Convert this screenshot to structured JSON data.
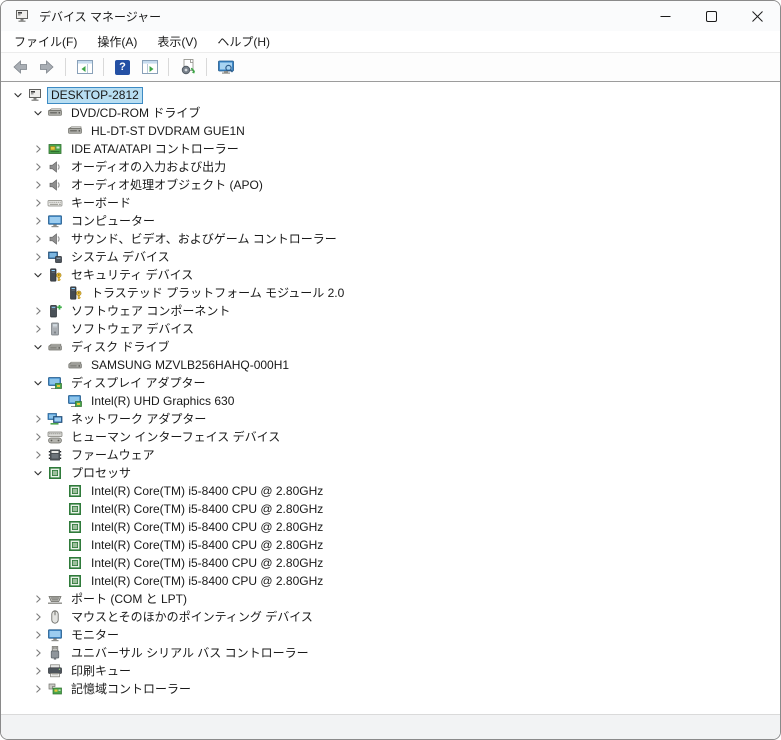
{
  "window": {
    "title": "デバイス マネージャー"
  },
  "window_controls": {
    "minimize_icon": "minimize-icon",
    "maximize_icon": "maximize-icon",
    "close_icon": "close-icon"
  },
  "menu": {
    "items": [
      {
        "id": "file",
        "label": "ファイル(F)"
      },
      {
        "id": "action",
        "label": "操作(A)"
      },
      {
        "id": "view",
        "label": "表示(V)"
      },
      {
        "id": "help",
        "label": "ヘルプ(H)"
      }
    ]
  },
  "toolbar": {
    "buttons": [
      {
        "name": "back",
        "icon": "back-arrow-icon"
      },
      {
        "name": "forward",
        "icon": "forward-arrow-icon"
      },
      {
        "type": "separator"
      },
      {
        "name": "show-console-tree",
        "icon": "show-tree-icon"
      },
      {
        "type": "separator"
      },
      {
        "name": "help",
        "icon": "help-icon"
      },
      {
        "name": "show-action-pane",
        "icon": "show-pane-icon"
      },
      {
        "type": "separator"
      },
      {
        "name": "scan-hardware-changes",
        "icon": "scan-hardware-icon"
      },
      {
        "type": "separator"
      },
      {
        "name": "remote-computer",
        "icon": "remote-monitor-icon"
      }
    ]
  },
  "tree": {
    "items": [
      {
        "label": "DESKTOP-2812",
        "icon": "computer-icon",
        "level": 0,
        "state": "expanded",
        "selected": true
      },
      {
        "label": "DVD/CD-ROM ドライブ",
        "icon": "cd-drive-icon",
        "level": 1,
        "state": "expanded"
      },
      {
        "label": "HL-DT-ST DVDRAM GUE1N",
        "icon": "cd-drive-icon",
        "level": 2,
        "state": "leaf"
      },
      {
        "label": "IDE ATA/ATAPI コントローラー",
        "icon": "ide-controller-icon",
        "level": 1,
        "state": "collapsed"
      },
      {
        "label": "オーディオの入力および出力",
        "icon": "speaker-icon",
        "level": 1,
        "state": "collapsed"
      },
      {
        "label": "オーディオ処理オブジェクト (APO)",
        "icon": "speaker-icon",
        "level": 1,
        "state": "collapsed"
      },
      {
        "label": "キーボード",
        "icon": "keyboard-icon",
        "level": 1,
        "state": "collapsed"
      },
      {
        "label": "コンピューター",
        "icon": "monitor-icon",
        "level": 1,
        "state": "collapsed"
      },
      {
        "label": "サウンド、ビデオ、およびゲーム コントローラー",
        "icon": "speaker-icon",
        "level": 1,
        "state": "collapsed"
      },
      {
        "label": "システム デバイス",
        "icon": "system-device-icon",
        "level": 1,
        "state": "collapsed"
      },
      {
        "label": "セキュリティ デバイス",
        "icon": "security-device-icon",
        "level": 1,
        "state": "expanded"
      },
      {
        "label": "トラステッド プラットフォーム モジュール 2.0",
        "icon": "security-device-icon",
        "level": 2,
        "state": "leaf"
      },
      {
        "label": "ソフトウェア コンポーネント",
        "icon": "software-component-icon",
        "level": 1,
        "state": "collapsed"
      },
      {
        "label": "ソフトウェア デバイス",
        "icon": "software-device-icon",
        "level": 1,
        "state": "collapsed"
      },
      {
        "label": "ディスク ドライブ",
        "icon": "disk-drive-icon",
        "level": 1,
        "state": "expanded"
      },
      {
        "label": "SAMSUNG MZVLB256HAHQ-000H1",
        "icon": "disk-drive-icon",
        "level": 2,
        "state": "leaf"
      },
      {
        "label": "ディスプレイ アダプター",
        "icon": "display-adapter-icon",
        "level": 1,
        "state": "expanded"
      },
      {
        "label": "Intel(R) UHD Graphics 630",
        "icon": "display-adapter-icon",
        "level": 2,
        "state": "leaf"
      },
      {
        "label": "ネットワーク アダプター",
        "icon": "network-adapter-icon",
        "level": 1,
        "state": "collapsed"
      },
      {
        "label": "ヒューマン インターフェイス デバイス",
        "icon": "hid-icon",
        "level": 1,
        "state": "collapsed"
      },
      {
        "label": "ファームウェア",
        "icon": "firmware-icon",
        "level": 1,
        "state": "collapsed"
      },
      {
        "label": "プロセッサ",
        "icon": "processor-icon",
        "level": 1,
        "state": "expanded"
      },
      {
        "label": "Intel(R) Core(TM) i5-8400 CPU @ 2.80GHz",
        "icon": "processor-icon",
        "level": 2,
        "state": "leaf"
      },
      {
        "label": "Intel(R) Core(TM) i5-8400 CPU @ 2.80GHz",
        "icon": "processor-icon",
        "level": 2,
        "state": "leaf"
      },
      {
        "label": "Intel(R) Core(TM) i5-8400 CPU @ 2.80GHz",
        "icon": "processor-icon",
        "level": 2,
        "state": "leaf"
      },
      {
        "label": "Intel(R) Core(TM) i5-8400 CPU @ 2.80GHz",
        "icon": "processor-icon",
        "level": 2,
        "state": "leaf"
      },
      {
        "label": "Intel(R) Core(TM) i5-8400 CPU @ 2.80GHz",
        "icon": "processor-icon",
        "level": 2,
        "state": "leaf"
      },
      {
        "label": "Intel(R) Core(TM) i5-8400 CPU @ 2.80GHz",
        "icon": "processor-icon",
        "level": 2,
        "state": "leaf"
      },
      {
        "label": "ポート (COM と LPT)",
        "icon": "port-icon",
        "level": 1,
        "state": "collapsed"
      },
      {
        "label": "マウスとそのほかのポインティング デバイス",
        "icon": "mouse-icon",
        "level": 1,
        "state": "collapsed"
      },
      {
        "label": "モニター",
        "icon": "monitor-icon",
        "level": 1,
        "state": "collapsed"
      },
      {
        "label": "ユニバーサル シリアル バス コントローラー",
        "icon": "usb-icon",
        "level": 1,
        "state": "collapsed"
      },
      {
        "label": "印刷キュー",
        "icon": "printer-icon",
        "level": 1,
        "state": "collapsed"
      },
      {
        "label": "記憶域コントローラー",
        "icon": "storage-controller-icon",
        "level": 1,
        "state": "collapsed"
      }
    ]
  },
  "statusbar": {
    "text": ""
  },
  "colors": {
    "selection_bg": "#b8def2",
    "selection_border": "#3d8bc4",
    "help_icon_bg": "#2450a4",
    "window_border": "#8a8a8a",
    "tree_top_border": "#9c9c9c"
  }
}
